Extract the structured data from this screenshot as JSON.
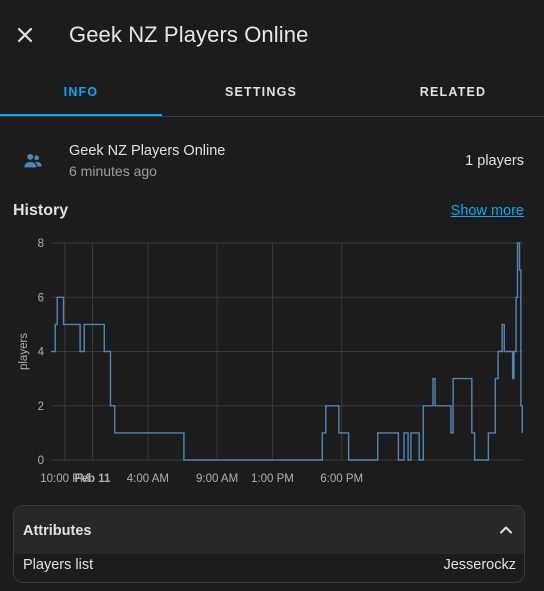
{
  "dialog": {
    "title": "Geek NZ Players Online",
    "close_icon": "close-icon"
  },
  "tabs": [
    {
      "label": "INFO",
      "active": true
    },
    {
      "label": "SETTINGS",
      "active": false
    },
    {
      "label": "RELATED",
      "active": false
    }
  ],
  "entity": {
    "icon": "account-group-icon",
    "name": "Geek NZ Players Online",
    "last_changed": "6 minutes ago",
    "state": "1 players"
  },
  "history": {
    "title": "History",
    "show_more": "Show more"
  },
  "chart_data": {
    "type": "line",
    "ylabel": "players",
    "ylim": [
      0,
      8
    ],
    "yticks": [
      "0",
      "2",
      "4",
      "6",
      "8"
    ],
    "xticks": [
      "10:00 PM",
      "Feb 11",
      "4:00 AM",
      "9:00 AM",
      "1:00 PM",
      "6:00 PM"
    ],
    "x_unit": "hours since 9:00 PM Feb 10",
    "series": [
      {
        "name": "players",
        "color": "#4f86b8",
        "points": [
          [
            0.0,
            4
          ],
          [
            0.3,
            4
          ],
          [
            0.3,
            5
          ],
          [
            0.45,
            5
          ],
          [
            0.45,
            6
          ],
          [
            0.9,
            6
          ],
          [
            0.9,
            5
          ],
          [
            2.1,
            5
          ],
          [
            2.1,
            4
          ],
          [
            2.4,
            4
          ],
          [
            2.4,
            5
          ],
          [
            3.85,
            5
          ],
          [
            3.85,
            4
          ],
          [
            4.3,
            4
          ],
          [
            4.3,
            2
          ],
          [
            4.6,
            2
          ],
          [
            4.6,
            1
          ],
          [
            9.6,
            1
          ],
          [
            9.6,
            0
          ],
          [
            19.6,
            0
          ],
          [
            19.6,
            1
          ],
          [
            19.85,
            1
          ],
          [
            19.85,
            2
          ],
          [
            20.8,
            2
          ],
          [
            20.8,
            1
          ],
          [
            21.5,
            1
          ],
          [
            21.5,
            0
          ],
          [
            23.6,
            0
          ],
          [
            23.6,
            1
          ],
          [
            25.1,
            1
          ],
          [
            25.1,
            0
          ],
          [
            25.5,
            0
          ],
          [
            25.5,
            1
          ],
          [
            25.8,
            1
          ],
          [
            25.8,
            0
          ],
          [
            26.0,
            0
          ],
          [
            26.0,
            1
          ],
          [
            26.6,
            1
          ],
          [
            26.6,
            0
          ],
          [
            26.9,
            0
          ],
          [
            26.9,
            2
          ],
          [
            27.6,
            2
          ],
          [
            27.6,
            3
          ],
          [
            27.75,
            3
          ],
          [
            27.75,
            2
          ],
          [
            28.9,
            2
          ],
          [
            28.9,
            1
          ],
          [
            29.05,
            1
          ],
          [
            29.05,
            3
          ],
          [
            30.4,
            3
          ],
          [
            30.4,
            1
          ],
          [
            30.6,
            1
          ],
          [
            30.6,
            0
          ],
          [
            31.6,
            0
          ],
          [
            31.6,
            1
          ],
          [
            32.1,
            1
          ],
          [
            32.1,
            3
          ],
          [
            32.3,
            3
          ],
          [
            32.3,
            4
          ],
          [
            32.6,
            4
          ],
          [
            32.6,
            5
          ],
          [
            32.75,
            5
          ],
          [
            32.75,
            4
          ],
          [
            33.35,
            4
          ],
          [
            33.35,
            3
          ],
          [
            33.45,
            3
          ],
          [
            33.45,
            4
          ],
          [
            33.6,
            4
          ],
          [
            33.6,
            6
          ],
          [
            33.7,
            6
          ],
          [
            33.7,
            8
          ],
          [
            33.85,
            8
          ],
          [
            33.85,
            7
          ],
          [
            33.95,
            7
          ],
          [
            33.95,
            2
          ],
          [
            34.05,
            2
          ],
          [
            34.05,
            1
          ]
        ]
      }
    ]
  },
  "attributes": {
    "title": "Attributes",
    "chevron_icon": "chevron-up-icon",
    "rows": [
      {
        "key": "Players list",
        "value": "Jesserockz"
      }
    ]
  }
}
